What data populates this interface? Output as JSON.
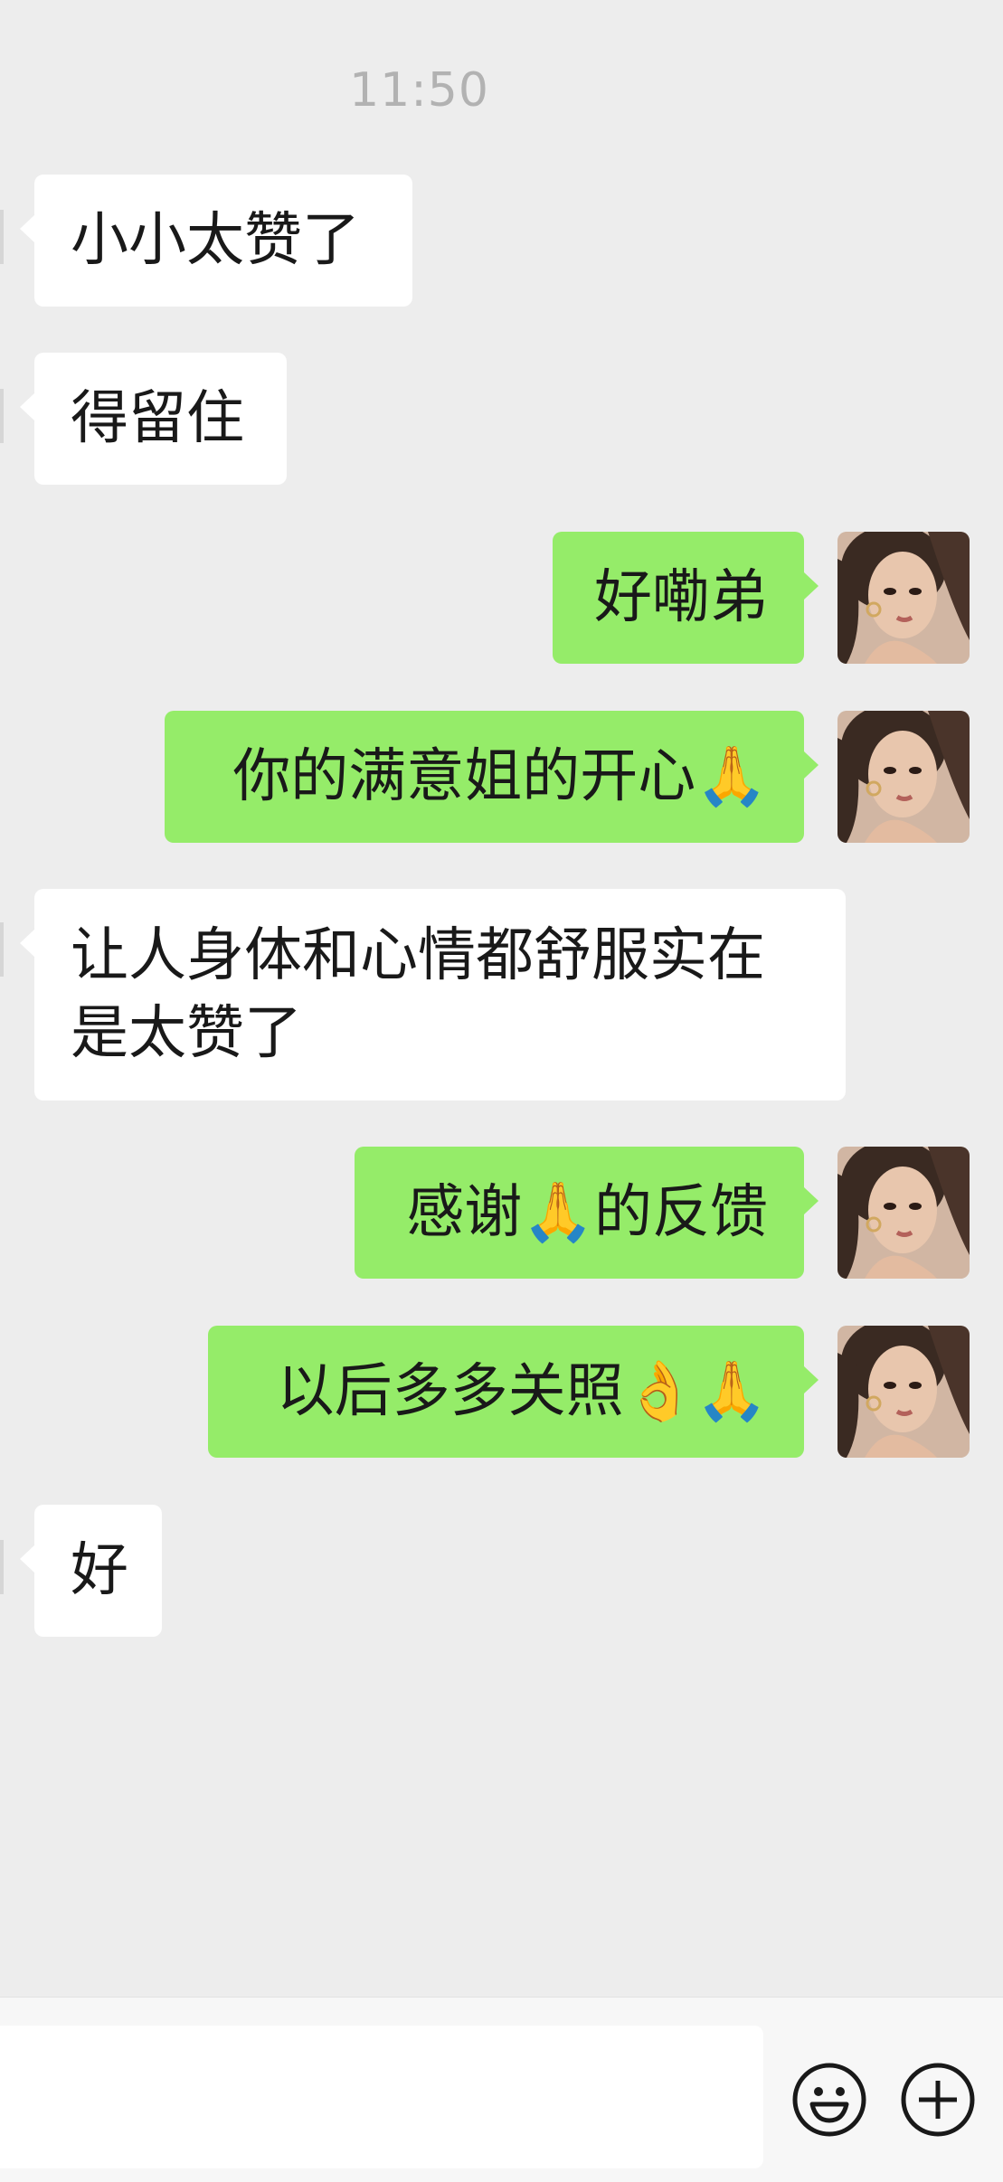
{
  "chat": {
    "timestamp": "11:50",
    "messages": [
      {
        "side": "in",
        "text": "小小太赞了"
      },
      {
        "side": "in",
        "text": "得留住"
      },
      {
        "side": "out",
        "text": "好嘞弟"
      },
      {
        "side": "out",
        "text": "你的满意姐的开心🙏"
      },
      {
        "side": "in",
        "line1": "让人身体和心情都舒服实在",
        "line2": "是太赞了"
      },
      {
        "side": "out",
        "text": "感谢🙏的反馈"
      },
      {
        "side": "out",
        "text": "以后多多关照👌🙏"
      },
      {
        "side": "in",
        "text": "好"
      }
    ]
  },
  "input": {
    "value": "",
    "emoji_icon": "smiley-icon",
    "plus_icon": "plus-circle-icon"
  },
  "colors": {
    "background": "#ededed",
    "bubble_in": "#ffffff",
    "bubble_out": "#95ec69",
    "timestamp": "#b2b2b2"
  }
}
